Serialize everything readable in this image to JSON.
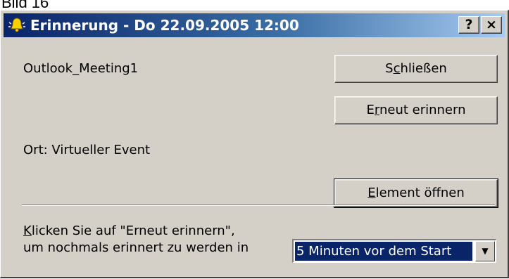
{
  "caption": "Bild 16",
  "window": {
    "title": "Erinnerung - Do 22.09.2005 12:00",
    "help_label": "?",
    "close_label": "×"
  },
  "reminder": {
    "subject": "Outlook_Meeting1",
    "location": "Ort: Virtueller Event"
  },
  "buttons": {
    "dismiss": {
      "accel": "c",
      "before": "S",
      "after": "hließen"
    },
    "snooze": {
      "accel": "r",
      "before": "E",
      "after": "neut erinnern"
    },
    "open": {
      "accel": "E",
      "before": "",
      "after": "lement öffnen"
    }
  },
  "footer": {
    "line1_accel": "K",
    "line1_rest": "licken Sie auf \"Erneut erinnern\",",
    "line2": "um nochmals erinnert zu werden in",
    "snooze_option": "5 Minuten vor dem Start"
  },
  "icons": {
    "title": "bell-icon",
    "dropdown": "dropdown-arrow-icon"
  },
  "colors": {
    "titlebar_start": "#0a246a",
    "titlebar_end": "#a6caf0",
    "dialog_bg": "#d4d0c8",
    "selection": "#0a246a"
  }
}
